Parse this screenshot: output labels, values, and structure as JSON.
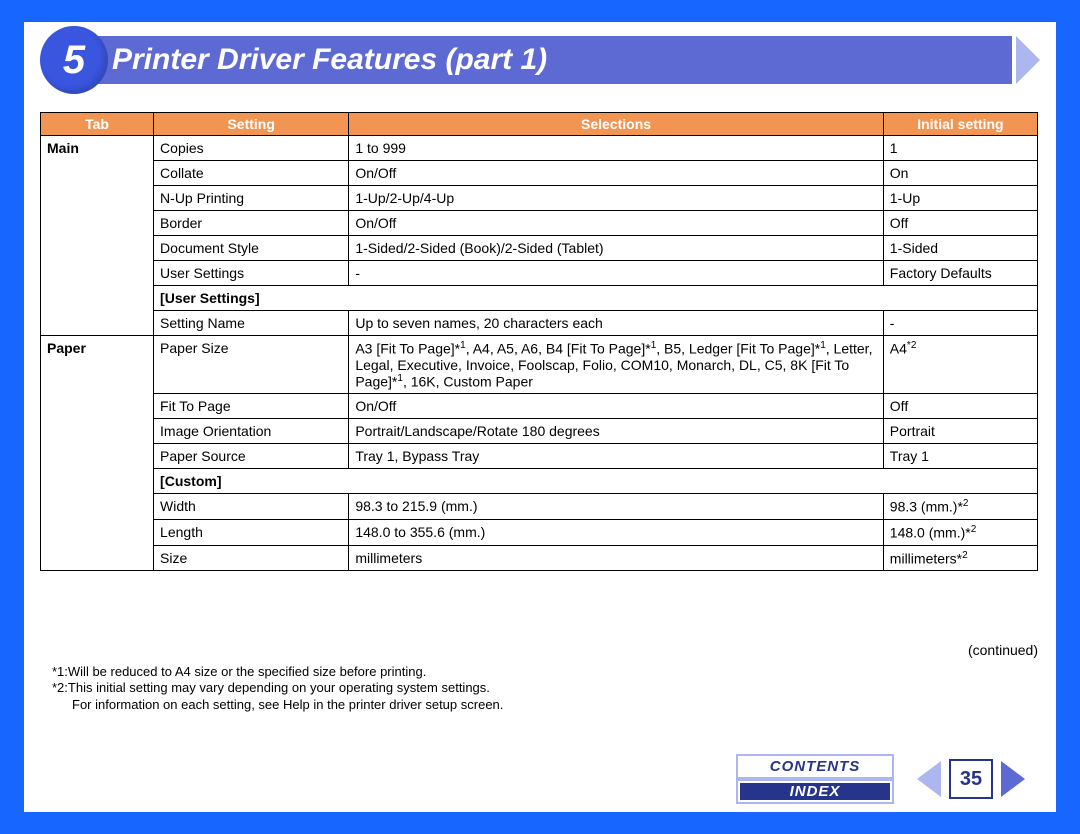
{
  "chapter_number": "5",
  "title": "Printer Driver Features (part 1)",
  "table": {
    "headers": [
      "Tab",
      "Setting",
      "Selections",
      "Initial setting"
    ],
    "groups": [
      {
        "tab": "Main",
        "rows": [
          {
            "setting": "Copies",
            "selections": "1 to 999",
            "initial": "1"
          },
          {
            "setting": "Collate",
            "selections": "On/Off",
            "initial": "On"
          },
          {
            "setting": "N-Up Printing",
            "selections": "1-Up/2-Up/4-Up",
            "initial": "1-Up"
          },
          {
            "setting": "Border",
            "selections": "On/Off",
            "initial": "Off"
          },
          {
            "setting": "Document Style",
            "selections": "1-Sided/2-Sided (Book)/2-Sided (Tablet)",
            "initial": "1-Sided"
          },
          {
            "setting": "User Settings",
            "selections": "-",
            "initial": "Factory Defaults"
          }
        ],
        "subgroup_label": "[User Settings]",
        "sub_rows": [
          {
            "setting": "Setting Name",
            "selections": "Up to seven names, 20 characters each",
            "initial": "-"
          }
        ]
      },
      {
        "tab": "Paper",
        "rows": [
          {
            "setting": "Paper Size",
            "selections_html": "A3 [Fit To Page]*1, A4, A5, A6, B4 [Fit To Page]*1, B5, Ledger [Fit To Page]*1, Letter, Legal, Executive, Invoice, Foolscap, Folio, COM10, Monarch, DL, C5, 8K [Fit To Page]*1, 16K, Custom Paper",
            "initial_html": "A4*2"
          },
          {
            "setting": "Fit To Page",
            "selections": "On/Off",
            "initial": "Off"
          },
          {
            "setting": "Image Orientation",
            "selections": "Portrait/Landscape/Rotate 180 degrees",
            "initial": "Portrait"
          },
          {
            "setting": "Paper Source",
            "selections": "Tray 1, Bypass Tray",
            "initial": "Tray 1"
          }
        ],
        "subgroup_label": "[Custom]",
        "sub_rows": [
          {
            "setting": "Width",
            "selections": "98.3 to 215.9 (mm.)",
            "initial_html": "98.3 (mm.)*2"
          },
          {
            "setting": "Length",
            "selections": "148.0 to 355.6 (mm.)",
            "initial_html": "148.0 (mm.)*2"
          },
          {
            "setting": "Size",
            "selections": "millimeters",
            "initial_html": "millimeters*2"
          }
        ]
      }
    ]
  },
  "continued": "(continued)",
  "footnotes": [
    "*1:Will be reduced to A4 size or the specified size before printing.",
    "*2:This initial setting may vary depending on your operating system settings.",
    "For information on each setting, see Help in the printer driver setup screen."
  ],
  "nav": {
    "contents": "CONTENTS",
    "index": "INDEX",
    "page_number": "35"
  }
}
